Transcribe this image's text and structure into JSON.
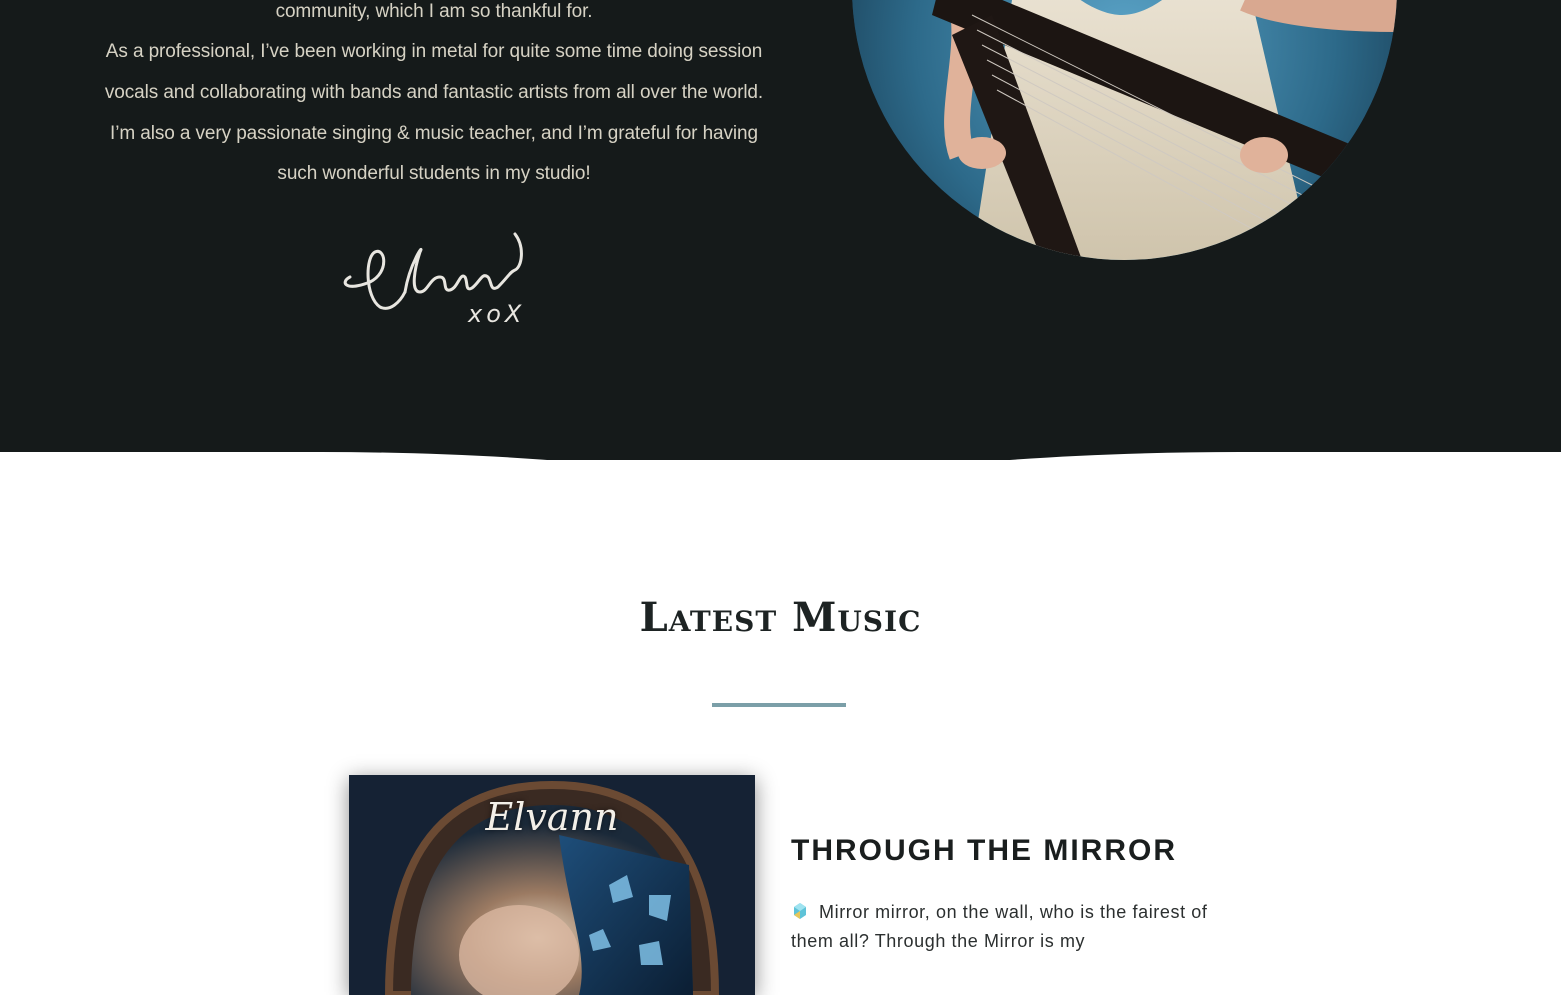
{
  "about": {
    "line_top": "community, which I am so thankful for.",
    "paragraph": "As a professional, I’ve been working in metal for quite some time doing session vocals and collaborating with bands and fantastic artists from all over the world.   I’m also a very passionate singing & music teacher, and I’m grateful for having such wonderful students in my studio!",
    "signature_text": "Elvann xoX"
  },
  "latest_music": {
    "title": "Latest Music",
    "album_cover_text": "Elvann",
    "song_title": "THROUGH THE MIRROR",
    "song_description": "Mirror mirror, on the wall, who is the fairest of them all? Through the Mirror is my"
  },
  "colors": {
    "dark_bg": "#151a1a",
    "accent_line": "#7b9fa8",
    "text_light": "#d6d2c4"
  },
  "icons": [
    "signature-graphic",
    "gem-icon"
  ]
}
